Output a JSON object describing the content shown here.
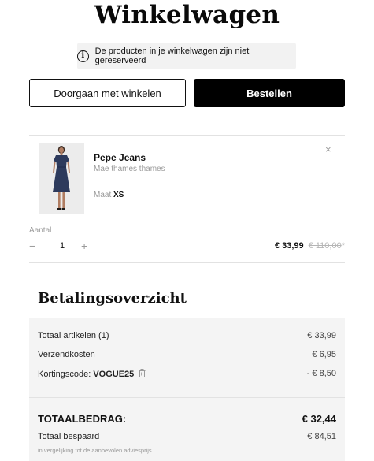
{
  "page": {
    "title": "Winkelwagen"
  },
  "notice": {
    "icon": "info-icon",
    "text": "De producten in je winkelwagen zijn niet gereserveerd"
  },
  "actions": {
    "continue_label": "Doorgaan met winkelen",
    "order_label": "Bestellen"
  },
  "cart_item": {
    "brand": "Pepe Jeans",
    "name": "Mae thames thames",
    "size_label": "Maat",
    "size_value": "XS",
    "quantity_label": "Aantal",
    "minus": "−",
    "quantity": "1",
    "plus": "+",
    "price": "€ 33,99",
    "original_price": "€ 110,00",
    "original_price_marker": "*",
    "remove": "×"
  },
  "summary": {
    "title": "Betalingsoverzicht",
    "items_label": "Totaal artikelen (1)",
    "items_value": "€ 33,99",
    "shipping_label": "Verzendkosten",
    "shipping_value": "€ 6,95",
    "discount_label": "Kortingscode:",
    "discount_code": "VOGUE25",
    "discount_value": "- € 8,50",
    "total_label": "TOTAALBEDRAG:",
    "total_value": "€ 32,44",
    "saved_label": "Totaal bespaard",
    "saved_value": "€ 84,51",
    "footnote": "in vergelijking tot de aanbevolen adviesprijs"
  },
  "colors": {
    "primary": "#000000",
    "muted": "#9a9a9a",
    "panel": "#f4f4f4"
  }
}
